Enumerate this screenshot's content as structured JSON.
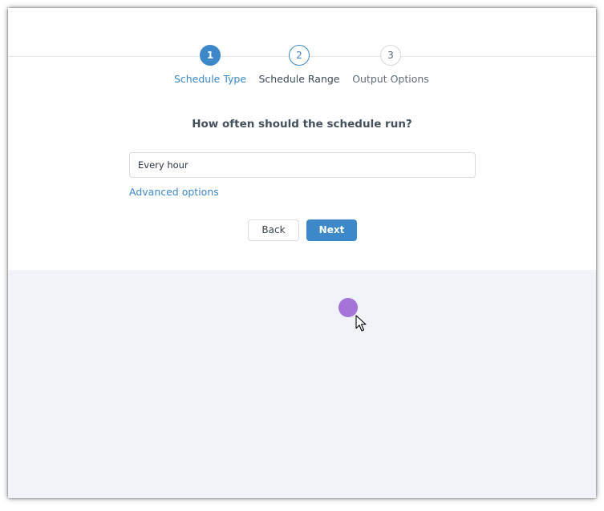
{
  "wizard": {
    "steps": [
      {
        "number": "1",
        "label": "Schedule Type",
        "state": "active"
      },
      {
        "number": "2",
        "label": "Schedule Range",
        "state": "next"
      },
      {
        "number": "3",
        "label": "Output Options",
        "state": "pending"
      }
    ]
  },
  "form": {
    "question": "How often should the schedule run?",
    "frequency_value": "Every hour",
    "advanced_link": "Advanced options"
  },
  "actions": {
    "back_label": "Back",
    "next_label": "Next"
  },
  "theme": {
    "accent": "#3d88c9",
    "page_background": "#f0f3f7",
    "cursor_highlight": "#a474d8"
  },
  "icons": {
    "pointer": "mouse-pointer-icon"
  }
}
